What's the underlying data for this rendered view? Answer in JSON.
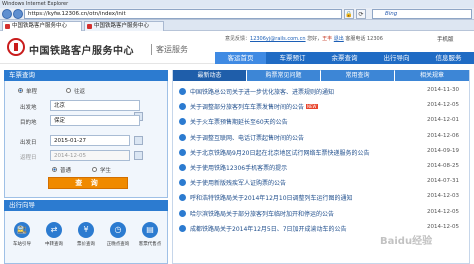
{
  "browser": {
    "window_title": "Windows Internet Explorer",
    "address": "https://kyfw.12306.cn/otn/index/init",
    "search_placeholder": "Bing",
    "tabs": [
      {
        "label": "中国铁路客户服务中心"
      },
      {
        "label": "中国铁路客户服务中心"
      }
    ]
  },
  "site": {
    "title": "中国铁路客户服务中心",
    "subtitle": "客运服务",
    "user": {
      "prefix": "意见反馈：",
      "email": "12306yj@rails.com.cn",
      "hello": "您好，",
      "name": "王丰",
      "logout": "退出",
      "hotline": "客服电话 12306"
    },
    "mobile": "手机版",
    "nav": [
      "客运首页",
      "车票预订",
      "余票查询",
      "出行导向",
      "信息服务"
    ]
  },
  "query": {
    "heading": "车票查询",
    "trip_types": [
      "单程",
      "往返"
    ],
    "from_label": "出发地",
    "from_value": "北京",
    "to_label": "目的地",
    "to_value": "保定",
    "date_label": "出发日",
    "date_value": "2015-01-27",
    "return_label": "返程日",
    "return_value": "2014-12-05",
    "passenger_types": [
      "普通",
      "学生"
    ],
    "button": "查 询"
  },
  "guide": {
    "heading": "出行向导",
    "items": [
      "车站引导",
      "中转查询",
      "票价查询",
      "正晚点查询",
      "客票代售点"
    ]
  },
  "news": {
    "tabs": [
      "最新动态",
      "购票常见问题",
      "常用查询",
      "相关规章"
    ],
    "items": [
      {
        "title": "中国铁路总公司关于进一步优化旅客、进票规则的通知",
        "date": "2014-11-30",
        "is_new": false
      },
      {
        "title": "关于调整部分旅客列车车票发售时间的公告",
        "date": "2014-12-05",
        "is_new": true
      },
      {
        "title": "关于火车票预售期延长至60天的公告",
        "date": "2014-12-01",
        "is_new": false
      },
      {
        "title": "关于调整互联网、电话订票起售时间的公告",
        "date": "2014-12-06",
        "is_new": false
      },
      {
        "title": "关于北京铁路局9月20日起在北京地区试行网络车票快递服务的公告",
        "date": "2014-09-19",
        "is_new": false
      },
      {
        "title": "关于使用铁路12306手机客票的提示",
        "date": "2014-08-25",
        "is_new": false
      },
      {
        "title": "关于使用新版残疾军人证购票的公告",
        "date": "2014-07-31",
        "is_new": false
      },
      {
        "title": "呼和浩特铁路局关于2014年12月10日调整列车运行图的通知",
        "date": "2014-12-03",
        "is_new": false
      },
      {
        "title": "哈尔滨铁路局关于部分旅客列车临时加开和停运的公告",
        "date": "2014-12-05",
        "is_new": false
      },
      {
        "title": "成都铁路局关于2014年12月5日、7日加开成渝动车的公告",
        "date": "2014-12-05",
        "is_new": false
      }
    ]
  },
  "colors": {
    "brand_blue": "#1f6bc4",
    "accent_orange": "#f08a00",
    "logo_red": "#c91c1c"
  },
  "watermark": "Baidu经验"
}
